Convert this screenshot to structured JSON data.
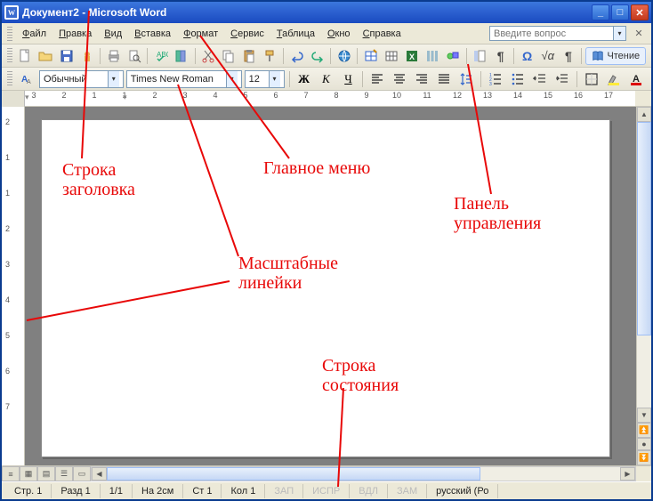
{
  "title": "Документ2 - Microsoft Word",
  "menu": [
    "Файл",
    "Правка",
    "Вид",
    "Вставка",
    "Формат",
    "Сервис",
    "Таблица",
    "Окно",
    "Справка"
  ],
  "ask_placeholder": "Введите вопрос",
  "style_combo": "Обычный",
  "font_combo": "Times New Roman",
  "size_combo": "12",
  "bold": "Ж",
  "italic": "К",
  "underline": "Ч",
  "reading_btn": "Чтение",
  "status": {
    "page": "Стр.  1",
    "section": "Разд 1",
    "pages": "1/1",
    "at": "На 2см",
    "line": "Ст 1",
    "col": "Кол 1",
    "rec": "ЗАП",
    "fix": "ИСПР",
    "ext": "ВДЛ",
    "ovr": "ЗАМ",
    "lang": "русский (Ро"
  },
  "annotations": {
    "titlebar": "Строка\nзаголовка",
    "menu": "Главное меню",
    "toolbar": "Панель\nуправления",
    "rulers": "Масштабные\nлинейки",
    "status": "Строка\nсостояния"
  },
  "ruler_h": [
    "3",
    "2",
    "1",
    "1",
    "2",
    "3",
    "4",
    "5",
    "6",
    "7",
    "8",
    "9",
    "10",
    "11",
    "12",
    "13",
    "14",
    "15",
    "16",
    "17"
  ]
}
